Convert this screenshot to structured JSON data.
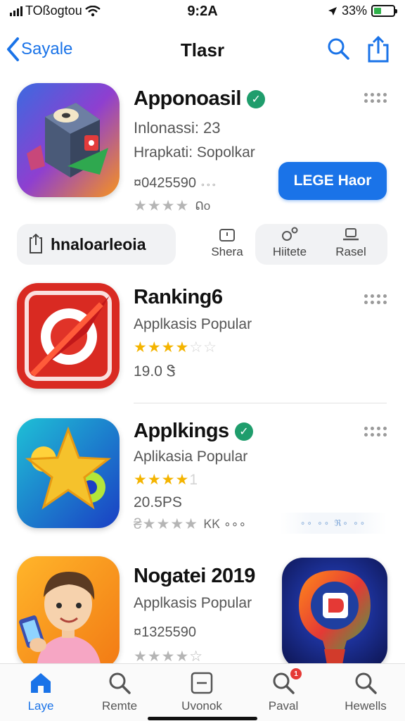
{
  "status_bar": {
    "carrier": "TOßogtou",
    "time": "9:2A",
    "battery": "33%"
  },
  "nav": {
    "back_label": "Sayale",
    "title": "Tlasr"
  },
  "apps": [
    {
      "name": "Apponoasil",
      "line1": "Inlonassi: 23",
      "line2": "Hrapkati: Sopolkar",
      "price": "¤0425590",
      "price_suffix": "∘∘∘",
      "stars_on": "",
      "stars_grey": "★★★★",
      "rating_count": "ᕠo"
    },
    {
      "name": "Ranking6",
      "line1": "Applkasis Popular",
      "stars_on": "★★★★",
      "stars_off": "☆☆",
      "line2": "19.0 Ꮥ"
    },
    {
      "name": "Applkings",
      "line1": "Aplikasia Popular",
      "stars_on": "★★★★",
      "stars_off": "1",
      "line2": "20.5PS",
      "sub_stars": "₴★★★★",
      "sub_count": "ᏦᏦ ∘∘∘"
    },
    {
      "name": "Nogatei 2019",
      "line1": "Applkasis Popular",
      "price": "¤1325590",
      "stars_grey": "★★★★☆"
    }
  ],
  "get_button": "LEGE Haor",
  "action_strip": {
    "left_label": "hnaloarleoia",
    "buttons": [
      "Shera",
      "Hiitete",
      "Rasel"
    ]
  },
  "blur_note": "∘∘ ∘∘ ℜ∘ ∘∘",
  "tabs": [
    {
      "label": "Laye",
      "icon": "home-icon",
      "active": true
    },
    {
      "label": "Remte",
      "icon": "search-icon"
    },
    {
      "label": "Uvonok",
      "icon": "updates-icon"
    },
    {
      "label": "Paval",
      "icon": "search-badge-icon",
      "badge": "1"
    },
    {
      "label": "Hewells",
      "icon": "search-icon"
    }
  ],
  "colors": {
    "accent": "#1a73e8",
    "verified": "#1f9d6c",
    "star": "#f4b400",
    "badge": "#e53935"
  }
}
